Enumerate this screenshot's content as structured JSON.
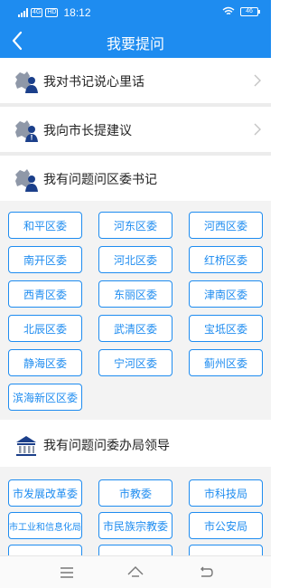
{
  "status_bar": {
    "network": "4G",
    "hd_badge": "HD",
    "time": "18:12",
    "battery": "46"
  },
  "header": {
    "title": "我要提问"
  },
  "menu": [
    {
      "label": "我对书记说心里话",
      "icon": "party-secretary-icon"
    },
    {
      "label": "我向市长提建议",
      "icon": "mayor-icon"
    }
  ],
  "section_district": {
    "title": "我有问题问区委书记",
    "items": [
      "和平区委",
      "河东区委",
      "河西区委",
      "南开区委",
      "河北区委",
      "红桥区委",
      "西青区委",
      "东丽区委",
      "津南区委",
      "北辰区委",
      "武清区委",
      "宝坻区委",
      "静海区委",
      "宁河区委",
      "蓟州区委",
      "滨海新区区委"
    ]
  },
  "section_bureau": {
    "title": "我有问题问委办局领导",
    "items": [
      "市发展改革委",
      "市教委",
      "市科技局",
      "市工业和信息化局",
      "市民族宗教委",
      "市公安局"
    ]
  },
  "colors": {
    "accent": "#1e8cf0",
    "divider": "#ececec",
    "grid_background": "#f3f3f3"
  },
  "nav_icons": [
    "menu-icon",
    "home-icon",
    "back-icon"
  ]
}
